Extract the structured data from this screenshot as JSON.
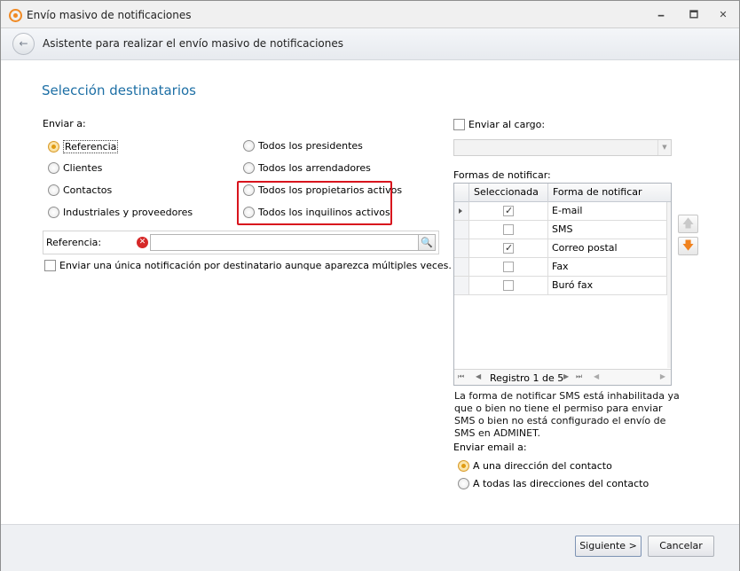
{
  "window": {
    "title": "Envío masivo de notificaciones",
    "minimize_glyph": "🗕",
    "maximize_glyph": "🗖",
    "close_glyph": "✕"
  },
  "wizard": {
    "back_glyph": "←",
    "title": "Asistente para realizar el envío masivo de notificaciones"
  },
  "section": {
    "title": "Selección destinatarios"
  },
  "enviar_a": {
    "label": "Enviar a:",
    "options": [
      {
        "label": "Referencia",
        "selected": true
      },
      {
        "label": "Clientes",
        "selected": false
      },
      {
        "label": "Contactos",
        "selected": false
      },
      {
        "label": "Industriales y proveedores",
        "selected": false
      },
      {
        "label": "Todos los presidentes",
        "selected": false
      },
      {
        "label": "Todos los arrendadores",
        "selected": false
      },
      {
        "label": "Todos los propietarios activos",
        "selected": false
      },
      {
        "label": "Todos los inquilinos activos",
        "selected": false
      }
    ]
  },
  "referencia": {
    "label": "Referencia:",
    "error_glyph": "✕",
    "value": "",
    "search_glyph": "🔍"
  },
  "unica": {
    "label": "Enviar una única notificación por destinatario aunque aparezca múltiples veces.",
    "checked": false
  },
  "cargo": {
    "label": "Enviar al cargo:",
    "checked": false,
    "value": ""
  },
  "formas": {
    "label": "Formas de notificar:",
    "columns": [
      "Seleccionada",
      "Forma de notificar"
    ],
    "rows": [
      {
        "name": "E-mail",
        "selected": true
      },
      {
        "name": "SMS",
        "selected": false
      },
      {
        "name": "Correo postal",
        "selected": true
      },
      {
        "name": "Fax",
        "selected": false
      },
      {
        "name": "Buró fax",
        "selected": false
      }
    ],
    "nav_text": "Registro 1 de 5",
    "nav_first": "⏮",
    "nav_prev": "◀",
    "nav_next": "▶",
    "nav_last": "⏭"
  },
  "move_up_glyph": "🡅",
  "move_down_glyph": "🡇",
  "sms_info": "La forma de notificar SMS está inhabilitada ya que o bien no tiene el permiso para enviar SMS o bien no está configurado el envío de SMS en ADMINET.",
  "email": {
    "label": "Enviar email a:",
    "options": [
      {
        "label": "A una dirección del contacto",
        "selected": true
      },
      {
        "label": "A todas las direcciones del contacto",
        "selected": false
      }
    ]
  },
  "footer": {
    "next_label": "Siguiente >",
    "cancel_label": "Cancelar"
  },
  "colors": {
    "accent": "#1d6fa5",
    "highlight_border": "#d8141d",
    "radio_selected": "#e09b13",
    "arrow_orange": "#f0821e"
  }
}
